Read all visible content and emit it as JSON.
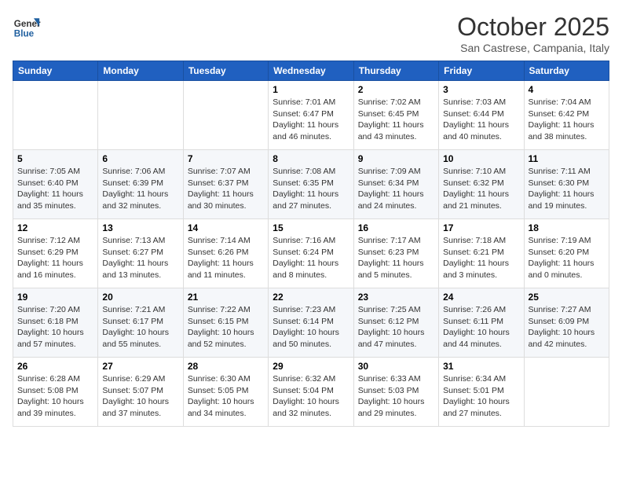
{
  "header": {
    "logo_general": "General",
    "logo_blue": "Blue",
    "month": "October 2025",
    "location": "San Castrese, Campania, Italy"
  },
  "weekdays": [
    "Sunday",
    "Monday",
    "Tuesday",
    "Wednesday",
    "Thursday",
    "Friday",
    "Saturday"
  ],
  "weeks": [
    [
      {
        "day": "",
        "info": ""
      },
      {
        "day": "",
        "info": ""
      },
      {
        "day": "",
        "info": ""
      },
      {
        "day": "1",
        "info": "Sunrise: 7:01 AM\nSunset: 6:47 PM\nDaylight: 11 hours\nand 46 minutes."
      },
      {
        "day": "2",
        "info": "Sunrise: 7:02 AM\nSunset: 6:45 PM\nDaylight: 11 hours\nand 43 minutes."
      },
      {
        "day": "3",
        "info": "Sunrise: 7:03 AM\nSunset: 6:44 PM\nDaylight: 11 hours\nand 40 minutes."
      },
      {
        "day": "4",
        "info": "Sunrise: 7:04 AM\nSunset: 6:42 PM\nDaylight: 11 hours\nand 38 minutes."
      }
    ],
    [
      {
        "day": "5",
        "info": "Sunrise: 7:05 AM\nSunset: 6:40 PM\nDaylight: 11 hours\nand 35 minutes."
      },
      {
        "day": "6",
        "info": "Sunrise: 7:06 AM\nSunset: 6:39 PM\nDaylight: 11 hours\nand 32 minutes."
      },
      {
        "day": "7",
        "info": "Sunrise: 7:07 AM\nSunset: 6:37 PM\nDaylight: 11 hours\nand 30 minutes."
      },
      {
        "day": "8",
        "info": "Sunrise: 7:08 AM\nSunset: 6:35 PM\nDaylight: 11 hours\nand 27 minutes."
      },
      {
        "day": "9",
        "info": "Sunrise: 7:09 AM\nSunset: 6:34 PM\nDaylight: 11 hours\nand 24 minutes."
      },
      {
        "day": "10",
        "info": "Sunrise: 7:10 AM\nSunset: 6:32 PM\nDaylight: 11 hours\nand 21 minutes."
      },
      {
        "day": "11",
        "info": "Sunrise: 7:11 AM\nSunset: 6:30 PM\nDaylight: 11 hours\nand 19 minutes."
      }
    ],
    [
      {
        "day": "12",
        "info": "Sunrise: 7:12 AM\nSunset: 6:29 PM\nDaylight: 11 hours\nand 16 minutes."
      },
      {
        "day": "13",
        "info": "Sunrise: 7:13 AM\nSunset: 6:27 PM\nDaylight: 11 hours\nand 13 minutes."
      },
      {
        "day": "14",
        "info": "Sunrise: 7:14 AM\nSunset: 6:26 PM\nDaylight: 11 hours\nand 11 minutes."
      },
      {
        "day": "15",
        "info": "Sunrise: 7:16 AM\nSunset: 6:24 PM\nDaylight: 11 hours\nand 8 minutes."
      },
      {
        "day": "16",
        "info": "Sunrise: 7:17 AM\nSunset: 6:23 PM\nDaylight: 11 hours\nand 5 minutes."
      },
      {
        "day": "17",
        "info": "Sunrise: 7:18 AM\nSunset: 6:21 PM\nDaylight: 11 hours\nand 3 minutes."
      },
      {
        "day": "18",
        "info": "Sunrise: 7:19 AM\nSunset: 6:20 PM\nDaylight: 11 hours\nand 0 minutes."
      }
    ],
    [
      {
        "day": "19",
        "info": "Sunrise: 7:20 AM\nSunset: 6:18 PM\nDaylight: 10 hours\nand 57 minutes."
      },
      {
        "day": "20",
        "info": "Sunrise: 7:21 AM\nSunset: 6:17 PM\nDaylight: 10 hours\nand 55 minutes."
      },
      {
        "day": "21",
        "info": "Sunrise: 7:22 AM\nSunset: 6:15 PM\nDaylight: 10 hours\nand 52 minutes."
      },
      {
        "day": "22",
        "info": "Sunrise: 7:23 AM\nSunset: 6:14 PM\nDaylight: 10 hours\nand 50 minutes."
      },
      {
        "day": "23",
        "info": "Sunrise: 7:25 AM\nSunset: 6:12 PM\nDaylight: 10 hours\nand 47 minutes."
      },
      {
        "day": "24",
        "info": "Sunrise: 7:26 AM\nSunset: 6:11 PM\nDaylight: 10 hours\nand 44 minutes."
      },
      {
        "day": "25",
        "info": "Sunrise: 7:27 AM\nSunset: 6:09 PM\nDaylight: 10 hours\nand 42 minutes."
      }
    ],
    [
      {
        "day": "26",
        "info": "Sunrise: 6:28 AM\nSunset: 5:08 PM\nDaylight: 10 hours\nand 39 minutes."
      },
      {
        "day": "27",
        "info": "Sunrise: 6:29 AM\nSunset: 5:07 PM\nDaylight: 10 hours\nand 37 minutes."
      },
      {
        "day": "28",
        "info": "Sunrise: 6:30 AM\nSunset: 5:05 PM\nDaylight: 10 hours\nand 34 minutes."
      },
      {
        "day": "29",
        "info": "Sunrise: 6:32 AM\nSunset: 5:04 PM\nDaylight: 10 hours\nand 32 minutes."
      },
      {
        "day": "30",
        "info": "Sunrise: 6:33 AM\nSunset: 5:03 PM\nDaylight: 10 hours\nand 29 minutes."
      },
      {
        "day": "31",
        "info": "Sunrise: 6:34 AM\nSunset: 5:01 PM\nDaylight: 10 hours\nand 27 minutes."
      },
      {
        "day": "",
        "info": ""
      }
    ]
  ]
}
